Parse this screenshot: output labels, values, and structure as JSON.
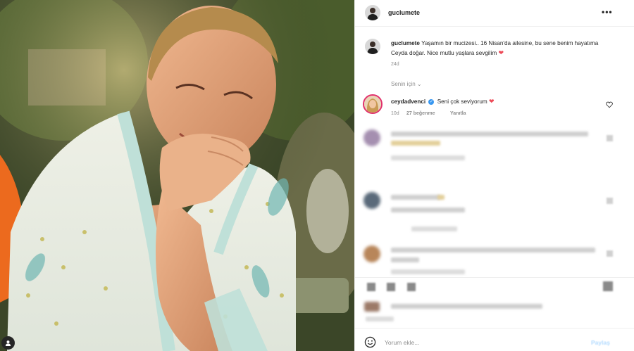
{
  "post": {
    "username": "guclumete",
    "caption_user": "guclumete",
    "caption_text": "Yaşamın bir mucizesi.. 16 Nisan'da ailesine, bu sene benim hayatıma Ceyda doğar. Nice mutlu yaşlara sevgilim",
    "caption_heart": "❤",
    "time_ago": "24d",
    "sort_label": "Senin için",
    "sort_chevron": "⌄",
    "more_label": "•••"
  },
  "comment": {
    "username": "ceydadvenci",
    "verified_glyph": "✓",
    "text": "Seni çok seviyorum",
    "heart": "❤",
    "time_ago": "10d",
    "likes": "27 beğenme",
    "reply_label": "Yanıtla"
  },
  "footer": {
    "add_comment_placeholder": "Yorum ekle...",
    "post_label": "Paylaş"
  },
  "colors": {
    "verified": "#3897f0",
    "heart": "#ed4956",
    "muted_text": "#8e8e8e",
    "primary_text": "#262626"
  },
  "icons": {
    "more": "more-options-icon",
    "like": "heart-outline-icon",
    "emoji": "emoji-icon",
    "tag": "user-tag-icon"
  }
}
